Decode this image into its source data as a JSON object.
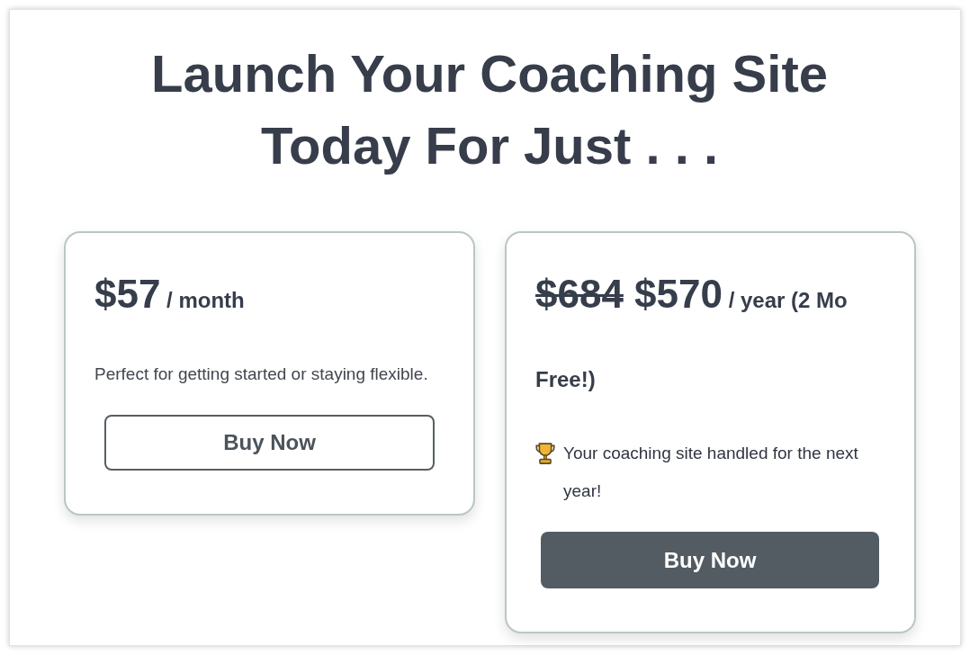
{
  "heading": "Launch Your Coaching Site Today For Just . . .",
  "plans": [
    {
      "price_parts": [
        {
          "kind": "amount",
          "text": "$57"
        },
        {
          "kind": "period",
          "text": "/ month"
        }
      ],
      "description": {
        "kind": "note",
        "text": "Perfect for getting started or staying flexible."
      },
      "button": {
        "kind": "outline",
        "label": "Buy Now"
      }
    },
    {
      "price_parts": [
        {
          "kind": "old",
          "text": "$684"
        },
        {
          "kind": "amount",
          "text": "$570"
        },
        {
          "kind": "period",
          "text": "/ year (2 Mo Free!)"
        }
      ],
      "description": {
        "kind": "benefit",
        "text": "Your coaching site handled for the next year!"
      },
      "button": {
        "kind": "filled",
        "label": "Buy Now"
      }
    }
  ]
}
